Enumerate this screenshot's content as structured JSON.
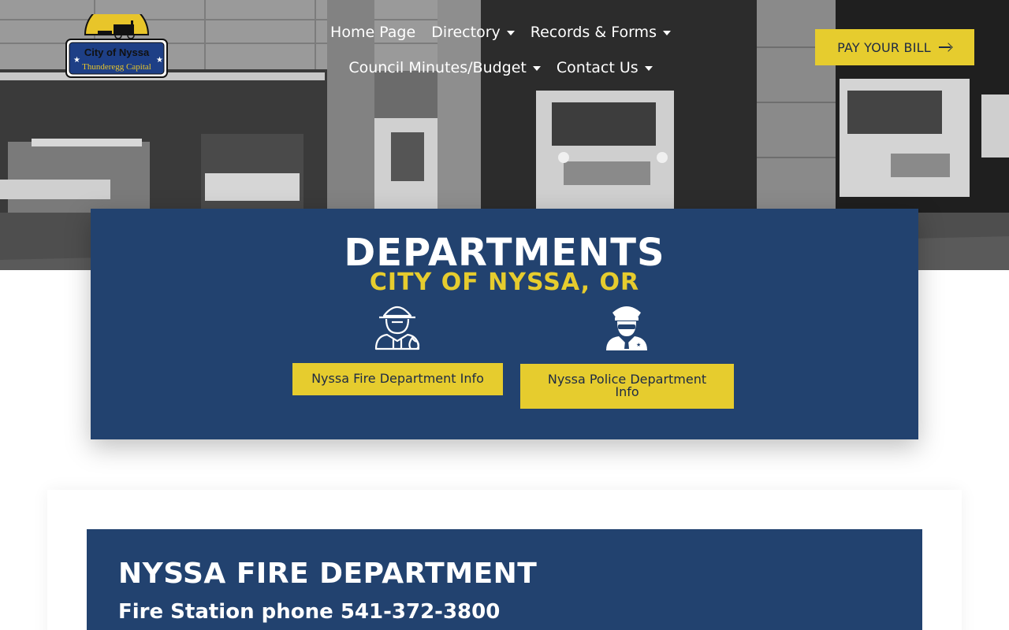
{
  "header": {
    "logo": {
      "title": "City of Nyssa",
      "tagline": "Thunderegg Capital"
    },
    "nav": {
      "row1": [
        {
          "label": "Home Page",
          "has_dropdown": false
        },
        {
          "label": "Directory",
          "has_dropdown": true
        },
        {
          "label": "Records & Forms",
          "has_dropdown": true
        }
      ],
      "row2": [
        {
          "label": "Council Minutes/Budget",
          "has_dropdown": true
        },
        {
          "label": "Contact Us",
          "has_dropdown": true
        }
      ]
    },
    "pay_button": {
      "label": "PAY YOUR BILL",
      "icon": "arrow-right-icon"
    }
  },
  "departments": {
    "title": "DEPARTMENTS",
    "subtitle": "CITY OF NYSSA, OR",
    "fire_button": "Nyssa Fire Department Info",
    "police_button": "Nyssa Police Department Info",
    "fire_icon": "firefighter-icon",
    "police_icon": "police-officer-icon"
  },
  "fire_section": {
    "heading": "NYSSA FIRE DEPARTMENT",
    "phone_line": "Fire Station phone 541-372-3800"
  },
  "colors": {
    "navy": "#22426f",
    "yellow": "#e6cc2e",
    "text_dark": "#1d2a44"
  }
}
